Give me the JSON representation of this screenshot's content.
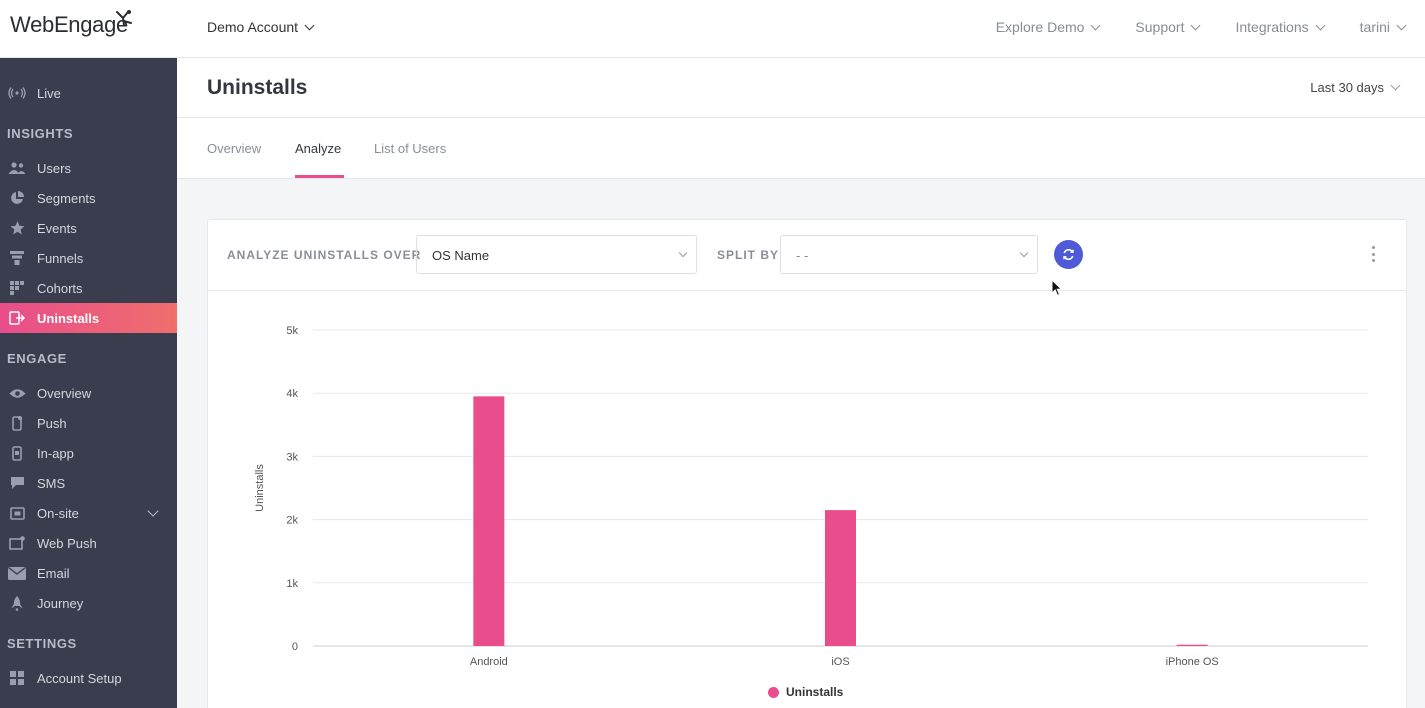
{
  "brand": {
    "logo_text": "WebEngage",
    "accent": "#e94d8b",
    "sidebar_bg": "#3a3d4d",
    "refresh_color": "#4e5ad7"
  },
  "topbar": {
    "account": "Demo Account",
    "nav": [
      "Explore Demo",
      "Support",
      "Integrations",
      "tarini"
    ]
  },
  "sidebar": {
    "live": {
      "label": "Live",
      "icon": "broadcast-icon"
    },
    "insights_title": "INSIGHTS",
    "insights": [
      {
        "label": "Users",
        "icon": "users-icon"
      },
      {
        "label": "Segments",
        "icon": "pie-icon"
      },
      {
        "label": "Events",
        "icon": "star-icon"
      },
      {
        "label": "Funnels",
        "icon": "funnel-icon"
      },
      {
        "label": "Cohorts",
        "icon": "grid-icon"
      },
      {
        "label": "Uninstalls",
        "icon": "uninstall-icon",
        "active": true
      }
    ],
    "engage_title": "ENGAGE",
    "engage": [
      {
        "label": "Overview",
        "icon": "eye-icon"
      },
      {
        "label": "Push",
        "icon": "mobile-icon"
      },
      {
        "label": "In-app",
        "icon": "tablet-icon"
      },
      {
        "label": "SMS",
        "icon": "chat-icon"
      },
      {
        "label": "On-site",
        "icon": "window-icon"
      },
      {
        "label": "Web Push",
        "icon": "browser-icon"
      },
      {
        "label": "Email",
        "icon": "mail-icon"
      },
      {
        "label": "Journey",
        "icon": "rocket-icon"
      }
    ],
    "settings_title": "SETTINGS",
    "settings": [
      {
        "label": "Account Setup",
        "icon": "grid-icon"
      }
    ]
  },
  "page": {
    "title": "Uninstalls",
    "date_range": "Last 30 days",
    "tabs": [
      "Overview",
      "Analyze",
      "List of Users"
    ],
    "active_tab": "Analyze"
  },
  "filters": {
    "analyze_label": "ANALYZE UNINSTALLS OVER",
    "analyze_value": "OS Name",
    "split_label": "SPLIT BY",
    "split_value": "- -"
  },
  "chart_data": {
    "type": "bar",
    "categories": [
      "Android",
      "iOS",
      "iPhone OS"
    ],
    "series": [
      {
        "name": "Uninstalls",
        "values": [
          3950,
          2150,
          20
        ],
        "color": "#e94d8b"
      }
    ],
    "ylabel": "Uninstalls",
    "ylim": [
      0,
      5000
    ],
    "yticks": [
      "0",
      "1k",
      "2k",
      "3k",
      "4k",
      "5k"
    ],
    "grid": true,
    "legend": "bottom-center"
  }
}
